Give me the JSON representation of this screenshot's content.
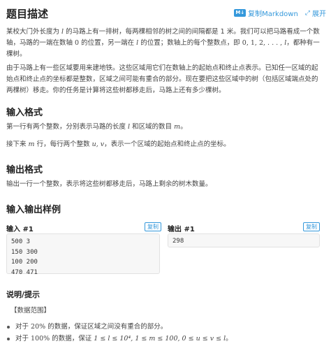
{
  "header": {
    "title": "题目描述",
    "copy_markdown_badge": "M↓",
    "copy_markdown": "复制Markdown",
    "expand_icon": "⤢",
    "expand": "展开"
  },
  "description": {
    "p1_a": "某校大门外长度为",
    "p1_var_l": "l",
    "p1_b": "的马路上有一排树，每两棵相邻的树之间的间隔都是 1 米。我们可以把马路看成一个数轴，马路的一端在数轴",
    "p1_zero": "0",
    "p1_c": "的位置，另一端在",
    "p1_var_l2": "l",
    "p1_d": "的位置；数轴上的每个整数点，即",
    "p1_seq": "0, 1, 2, . . . , ",
    "p1_var_l3": "l",
    "p1_e": "，都种有一棵树。",
    "p2": "由于马路上有一些区域要用来建地铁。这些区域用它们在数轴上的起始点和终止点表示。已知任一区域的起始点和终止点的坐标都是整数，区域之间可能有重合的部分。现在要把这些区域中的树（包括区域端点处的两棵树）移走。你的任务是计算将这些树都移走后，马路上还有多少棵树。"
  },
  "input_format": {
    "heading": "输入格式",
    "line1_a": "第一行有两个整数，分别表示马路的长度",
    "line1_var": "l",
    "line1_b": "和区域的数目",
    "line1_var2": "m",
    "line1_c": "。",
    "line2_a": "接下来",
    "line2_var": "m",
    "line2_b": "行，每行两个整数",
    "line2_vars": "u, v",
    "line2_c": "，表示一个区域的起始点和终止点的坐标。"
  },
  "output_format": {
    "heading": "输出格式",
    "line1": "输出一行一个整数，表示将这些树都移走后，马路上剩余的树木数量。"
  },
  "samples": {
    "heading": "输入输出样例",
    "input_label": "输入 #1",
    "output_label": "输出 #1",
    "copy_label": "复制",
    "input_lines": [
      "500 3",
      "150 300",
      "100 200",
      "470 471"
    ],
    "output_lines": [
      "298"
    ]
  },
  "hint": {
    "heading": "说明/提示",
    "data_range": "【数据范围】",
    "b1_a": "对于",
    "b1_pct": "20%",
    "b1_b": "的数据，保证区域之间没有重合的部分。",
    "b2_a": "对于",
    "b2_pct": "100%",
    "b2_b": "的数据，保证",
    "b2_math": "1 ≤ l ≤ 10⁴, 1 ≤ m ≤ 100, 0 ≤ u ≤ v ≤ l",
    "b2_c": "。"
  }
}
